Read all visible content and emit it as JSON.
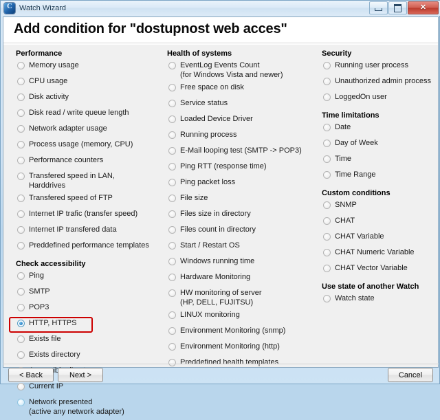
{
  "window": {
    "title": "Watch Wizard",
    "icon": "app-icon",
    "caption_buttons": {
      "minimize": "minimize-icon",
      "maximize": "maximize-icon",
      "close": "✕"
    }
  },
  "header": {
    "title": "Add condition for \"dostupnost web acces\""
  },
  "columns": [
    {
      "id": "col-1",
      "groups": [
        {
          "title": "Performance",
          "options": [
            {
              "label": "Memory usage",
              "state": "normal"
            },
            {
              "label": "CPU usage",
              "state": "normal"
            },
            {
              "label": "Disk activity",
              "state": "normal"
            },
            {
              "label": "Disk read / write queue length",
              "state": "normal"
            },
            {
              "label": "Network adapter usage",
              "state": "normal"
            },
            {
              "label": "Process usage (memory, CPU)",
              "state": "normal"
            },
            {
              "label": "Performance counters",
              "state": "normal"
            },
            {
              "label": "Transfered speed in LAN,",
              "label2": "Harddrives",
              "state": "normal"
            },
            {
              "label": "Transfered speed of FTP",
              "state": "normal"
            },
            {
              "label": "Internet IP trafic (transfer speed)",
              "state": "normal"
            },
            {
              "label": "Internet IP transfered data",
              "state": "normal"
            },
            {
              "label": "Preddefined performance templates",
              "state": "normal"
            }
          ]
        },
        {
          "title": "Check accessibility",
          "options": [
            {
              "label": "Ping",
              "state": "normal"
            },
            {
              "label": "SMTP",
              "state": "normal"
            },
            {
              "label": "POP3",
              "state": "normal"
            },
            {
              "label": "HTTP, HTTPS",
              "state": "checked"
            },
            {
              "label": "Exists file",
              "state": "normal"
            },
            {
              "label": "Exists directory",
              "state": "normal"
            },
            {
              "label": "Accessible directory",
              "state": "normal"
            },
            {
              "label": "Current IP",
              "state": "normal"
            },
            {
              "label": "Network presented",
              "label2": "(active any network adapter)",
              "state": "hover"
            }
          ]
        }
      ]
    },
    {
      "id": "col-2",
      "groups": [
        {
          "title": "Health of systems",
          "options": [
            {
              "label": "EventLog Events Count",
              "label2": "(for Windows Vista and newer)",
              "state": "normal"
            },
            {
              "label": "Free space on disk",
              "state": "normal"
            },
            {
              "label": "Service status",
              "state": "normal"
            },
            {
              "label": "Loaded Device Driver",
              "state": "normal"
            },
            {
              "label": "Running process",
              "state": "normal"
            },
            {
              "label": "E-Mail looping test (SMTP -> POP3)",
              "state": "normal"
            },
            {
              "label": "Ping RTT (response time)",
              "state": "normal"
            },
            {
              "label": "Ping packet loss",
              "state": "normal"
            },
            {
              "label": "File size",
              "state": "normal"
            },
            {
              "label": "Files size in directory",
              "state": "normal"
            },
            {
              "label": "Files count in directory",
              "state": "normal"
            },
            {
              "label": "Start / Restart OS",
              "state": "normal"
            },
            {
              "label": "Windows running time",
              "state": "normal"
            },
            {
              "label": "Hardware Monitoring",
              "state": "normal"
            },
            {
              "label": "HW monitoring of server",
              "label2": "(HP, DELL, FUJITSU)",
              "state": "normal"
            },
            {
              "label": "LINUX monitoring",
              "state": "normal"
            },
            {
              "label": "Environment Monitoring (snmp)",
              "state": "normal"
            },
            {
              "label": "Environment Monitoring (http)",
              "state": "normal"
            },
            {
              "label": "Preddefined health templates",
              "state": "normal"
            }
          ]
        }
      ]
    },
    {
      "id": "col-3",
      "groups": [
        {
          "title": "Security",
          "options": [
            {
              "label": "Running user process",
              "state": "normal"
            },
            {
              "label": "Unauthorized admin process",
              "state": "normal"
            },
            {
              "label": "LoggedOn user",
              "state": "normal"
            }
          ]
        },
        {
          "title": "Time limitations",
          "options": [
            {
              "label": "Date",
              "state": "normal"
            },
            {
              "label": "Day of Week",
              "state": "normal"
            },
            {
              "label": "Time",
              "state": "normal"
            },
            {
              "label": "Time Range",
              "state": "normal"
            }
          ]
        },
        {
          "title": "Custom conditions",
          "options": [
            {
              "label": "SNMP",
              "state": "normal"
            },
            {
              "label": "CHAT",
              "state": "normal"
            },
            {
              "label": "CHAT Variable",
              "state": "normal"
            },
            {
              "label": "CHAT Numeric Variable",
              "state": "normal"
            },
            {
              "label": "CHAT Vector Variable",
              "state": "normal"
            }
          ]
        },
        {
          "title": "Use state of another Watch",
          "options": [
            {
              "label": "Watch state",
              "state": "normal"
            }
          ]
        }
      ]
    }
  ],
  "annotation": {
    "target_label": "HTTP, HTTPS",
    "color": "#cc0000"
  },
  "footer": {
    "back_label": "< Back",
    "next_label": "Next >",
    "cancel_label": "Cancel"
  }
}
